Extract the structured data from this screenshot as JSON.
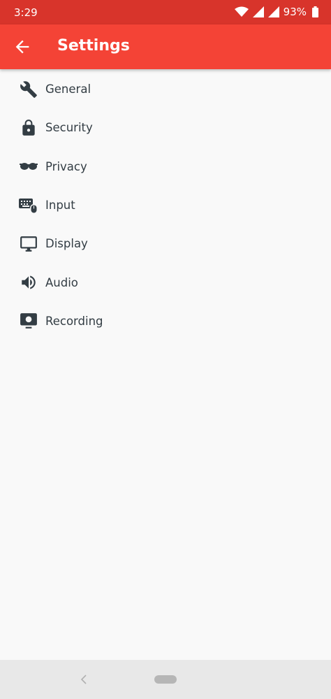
{
  "status_bar": {
    "time": "3:29",
    "battery": "93%",
    "icons": [
      "wifi-icon",
      "signal-icon",
      "signal-roaming-icon",
      "battery-icon"
    ]
  },
  "app_bar": {
    "title": "Settings",
    "back_icon": "arrow-back-icon",
    "color": "#f44336"
  },
  "settings": {
    "items": [
      {
        "label": "General",
        "icon": "wrench-icon"
      },
      {
        "label": "Security",
        "icon": "lock-icon"
      },
      {
        "label": "Privacy",
        "icon": "glasses-icon"
      },
      {
        "label": "Input",
        "icon": "keyboard-mouse-icon"
      },
      {
        "label": "Display",
        "icon": "monitor-icon"
      },
      {
        "label": "Audio",
        "icon": "speaker-icon"
      },
      {
        "label": "Recording",
        "icon": "recording-icon"
      }
    ]
  },
  "colors": {
    "status_bar": "#d8342b",
    "app_bar": "#f44336",
    "icon": "#333d44",
    "background": "#f9f9f9"
  }
}
